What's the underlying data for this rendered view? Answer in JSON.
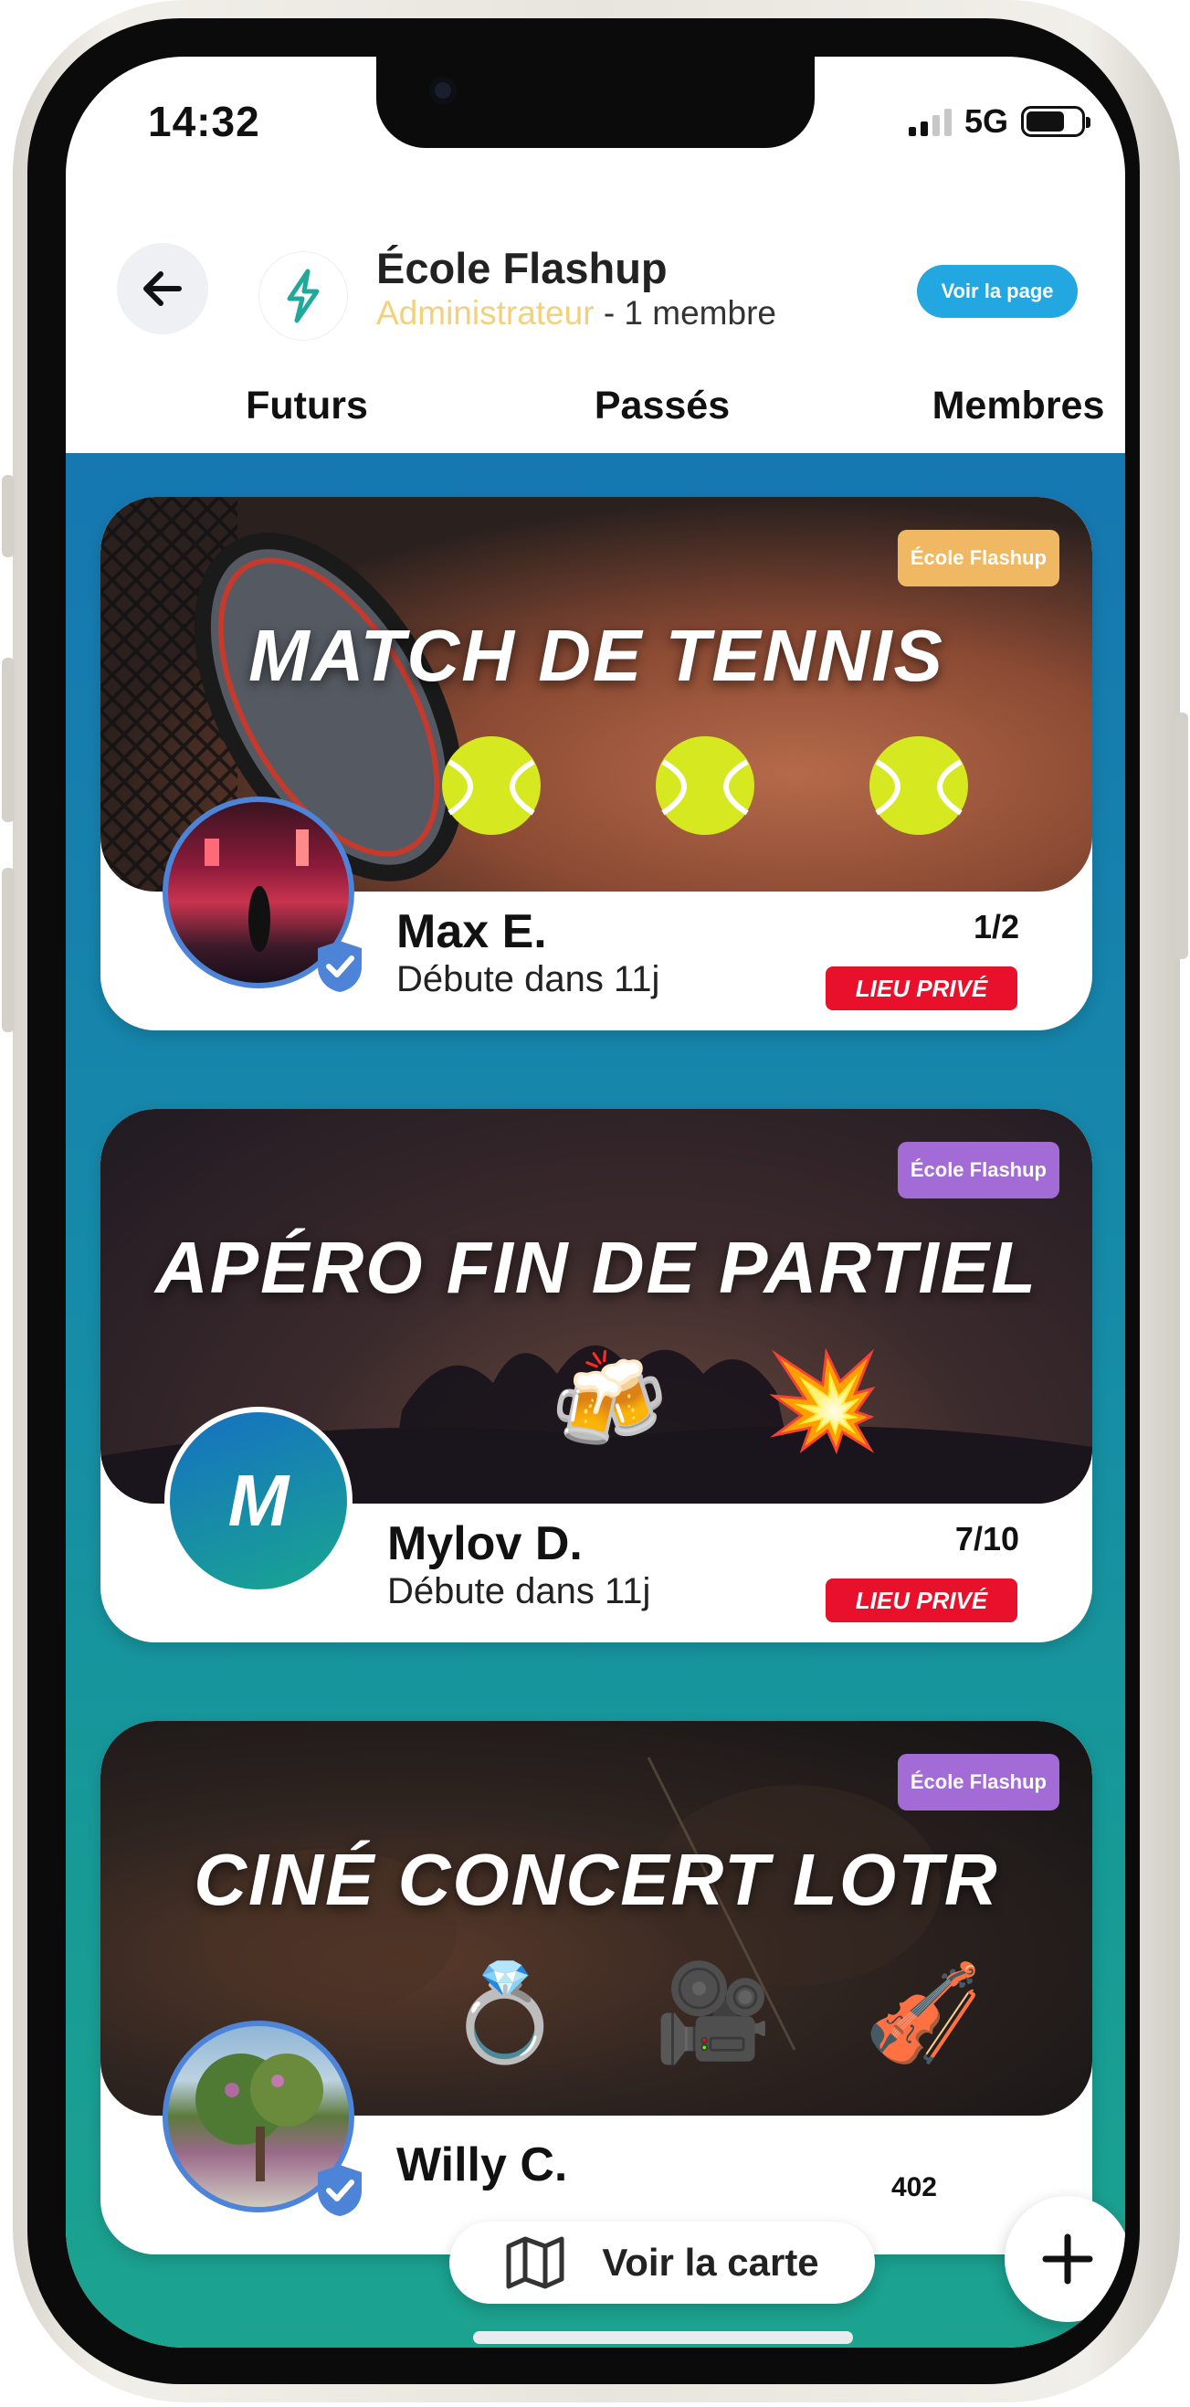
{
  "status_bar": {
    "time": "14:32",
    "network": "5G",
    "battery_level": 0.7
  },
  "header": {
    "org_name": "École Flashup",
    "role": "Administrateur",
    "members": "- 1 membre",
    "page_button": "Voir la page"
  },
  "tabs": [
    "Futurs",
    "Passés",
    "Membres"
  ],
  "active_tab": "Membres",
  "events": [
    {
      "title": "MATCH DE TENNIS",
      "tag": "École Flashup",
      "tag_color": "#f0b863",
      "host": "Max E.",
      "starts": "Débute dans 11j",
      "count": "1/2",
      "privacy": "LIEU PRIVÉ",
      "emojis": [
        "tennis-ball",
        "tennis-ball",
        "tennis-ball"
      ]
    },
    {
      "title": "APÉRO FIN DE PARTIEL",
      "tag": "École Flashup",
      "tag_color": "#a36bd6",
      "host": "Mylov D.",
      "avatar_letter": "M",
      "starts": "Débute dans 11j",
      "count": "7/10",
      "privacy": "LIEU PRIVÉ",
      "emojis": [
        "🍻",
        "💥"
      ]
    },
    {
      "title": "CINÉ CONCERT LOTR",
      "tag": "École Flashup",
      "tag_color": "#a36bd6",
      "host": "Willy C.",
      "count": "402",
      "emojis": [
        "💍",
        "🎥",
        "🎻"
      ]
    }
  ],
  "map_button": "Voir la carte",
  "fab": "+",
  "colors": {
    "accent": "#22a7e0",
    "danger": "#e8102a",
    "feed_top": "#1677b1",
    "feed_bottom": "#1ca38f"
  }
}
